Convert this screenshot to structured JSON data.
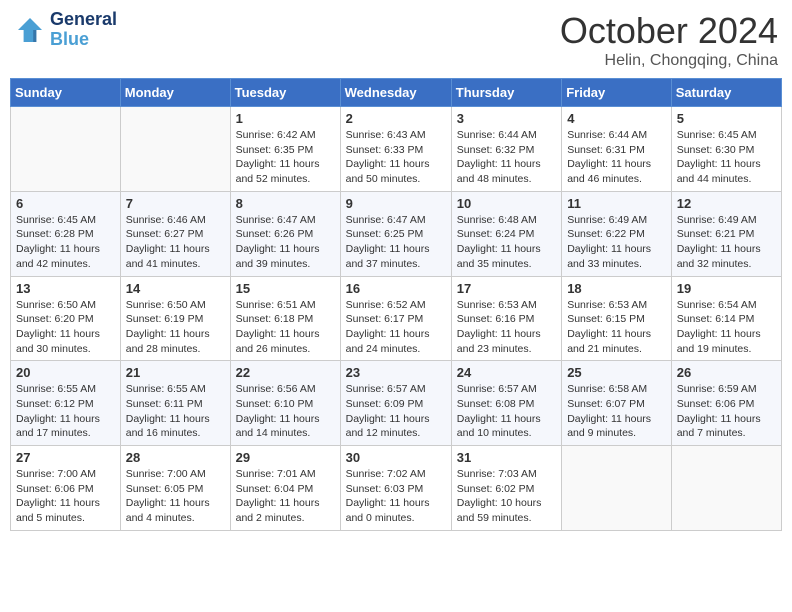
{
  "header": {
    "logo_line1": "General",
    "logo_line2": "Blue",
    "month": "October 2024",
    "location": "Helin, Chongqing, China"
  },
  "weekdays": [
    "Sunday",
    "Monday",
    "Tuesday",
    "Wednesday",
    "Thursday",
    "Friday",
    "Saturday"
  ],
  "weeks": [
    [
      {
        "day": "",
        "info": ""
      },
      {
        "day": "",
        "info": ""
      },
      {
        "day": "1",
        "info": "Sunrise: 6:42 AM\nSunset: 6:35 PM\nDaylight: 11 hours and 52 minutes."
      },
      {
        "day": "2",
        "info": "Sunrise: 6:43 AM\nSunset: 6:33 PM\nDaylight: 11 hours and 50 minutes."
      },
      {
        "day": "3",
        "info": "Sunrise: 6:44 AM\nSunset: 6:32 PM\nDaylight: 11 hours and 48 minutes."
      },
      {
        "day": "4",
        "info": "Sunrise: 6:44 AM\nSunset: 6:31 PM\nDaylight: 11 hours and 46 minutes."
      },
      {
        "day": "5",
        "info": "Sunrise: 6:45 AM\nSunset: 6:30 PM\nDaylight: 11 hours and 44 minutes."
      }
    ],
    [
      {
        "day": "6",
        "info": "Sunrise: 6:45 AM\nSunset: 6:28 PM\nDaylight: 11 hours and 42 minutes."
      },
      {
        "day": "7",
        "info": "Sunrise: 6:46 AM\nSunset: 6:27 PM\nDaylight: 11 hours and 41 minutes."
      },
      {
        "day": "8",
        "info": "Sunrise: 6:47 AM\nSunset: 6:26 PM\nDaylight: 11 hours and 39 minutes."
      },
      {
        "day": "9",
        "info": "Sunrise: 6:47 AM\nSunset: 6:25 PM\nDaylight: 11 hours and 37 minutes."
      },
      {
        "day": "10",
        "info": "Sunrise: 6:48 AM\nSunset: 6:24 PM\nDaylight: 11 hours and 35 minutes."
      },
      {
        "day": "11",
        "info": "Sunrise: 6:49 AM\nSunset: 6:22 PM\nDaylight: 11 hours and 33 minutes."
      },
      {
        "day": "12",
        "info": "Sunrise: 6:49 AM\nSunset: 6:21 PM\nDaylight: 11 hours and 32 minutes."
      }
    ],
    [
      {
        "day": "13",
        "info": "Sunrise: 6:50 AM\nSunset: 6:20 PM\nDaylight: 11 hours and 30 minutes."
      },
      {
        "day": "14",
        "info": "Sunrise: 6:50 AM\nSunset: 6:19 PM\nDaylight: 11 hours and 28 minutes."
      },
      {
        "day": "15",
        "info": "Sunrise: 6:51 AM\nSunset: 6:18 PM\nDaylight: 11 hours and 26 minutes."
      },
      {
        "day": "16",
        "info": "Sunrise: 6:52 AM\nSunset: 6:17 PM\nDaylight: 11 hours and 24 minutes."
      },
      {
        "day": "17",
        "info": "Sunrise: 6:53 AM\nSunset: 6:16 PM\nDaylight: 11 hours and 23 minutes."
      },
      {
        "day": "18",
        "info": "Sunrise: 6:53 AM\nSunset: 6:15 PM\nDaylight: 11 hours and 21 minutes."
      },
      {
        "day": "19",
        "info": "Sunrise: 6:54 AM\nSunset: 6:14 PM\nDaylight: 11 hours and 19 minutes."
      }
    ],
    [
      {
        "day": "20",
        "info": "Sunrise: 6:55 AM\nSunset: 6:12 PM\nDaylight: 11 hours and 17 minutes."
      },
      {
        "day": "21",
        "info": "Sunrise: 6:55 AM\nSunset: 6:11 PM\nDaylight: 11 hours and 16 minutes."
      },
      {
        "day": "22",
        "info": "Sunrise: 6:56 AM\nSunset: 6:10 PM\nDaylight: 11 hours and 14 minutes."
      },
      {
        "day": "23",
        "info": "Sunrise: 6:57 AM\nSunset: 6:09 PM\nDaylight: 11 hours and 12 minutes."
      },
      {
        "day": "24",
        "info": "Sunrise: 6:57 AM\nSunset: 6:08 PM\nDaylight: 11 hours and 10 minutes."
      },
      {
        "day": "25",
        "info": "Sunrise: 6:58 AM\nSunset: 6:07 PM\nDaylight: 11 hours and 9 minutes."
      },
      {
        "day": "26",
        "info": "Sunrise: 6:59 AM\nSunset: 6:06 PM\nDaylight: 11 hours and 7 minutes."
      }
    ],
    [
      {
        "day": "27",
        "info": "Sunrise: 7:00 AM\nSunset: 6:06 PM\nDaylight: 11 hours and 5 minutes."
      },
      {
        "day": "28",
        "info": "Sunrise: 7:00 AM\nSunset: 6:05 PM\nDaylight: 11 hours and 4 minutes."
      },
      {
        "day": "29",
        "info": "Sunrise: 7:01 AM\nSunset: 6:04 PM\nDaylight: 11 hours and 2 minutes."
      },
      {
        "day": "30",
        "info": "Sunrise: 7:02 AM\nSunset: 6:03 PM\nDaylight: 11 hours and 0 minutes."
      },
      {
        "day": "31",
        "info": "Sunrise: 7:03 AM\nSunset: 6:02 PM\nDaylight: 10 hours and 59 minutes."
      },
      {
        "day": "",
        "info": ""
      },
      {
        "day": "",
        "info": ""
      }
    ]
  ]
}
